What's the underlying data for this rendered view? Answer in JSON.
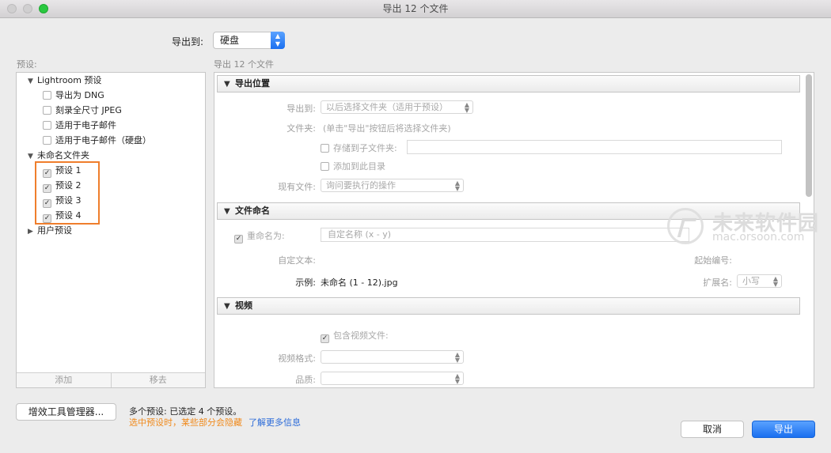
{
  "window": {
    "title": "导出 12 个文件"
  },
  "export_to": {
    "label": "导出到:",
    "value": "硬盘"
  },
  "presets": {
    "heading": "预设:",
    "groups": [
      {
        "label": "Lightroom 预设",
        "expanded": true,
        "items": [
          {
            "label": "导出为 DNG",
            "checked": false
          },
          {
            "label": "刻录全尺寸 JPEG",
            "checked": false
          },
          {
            "label": "适用于电子邮件",
            "checked": false
          },
          {
            "label": "适用于电子邮件（硬盘）",
            "checked": false
          }
        ]
      },
      {
        "label": "未命名文件夹",
        "expanded": true,
        "items": [
          {
            "label": "预设 1",
            "checked": true
          },
          {
            "label": "预设 2",
            "checked": true
          },
          {
            "label": "预设 3",
            "checked": true
          },
          {
            "label": "预设 4",
            "checked": true
          }
        ]
      },
      {
        "label": "用户预设",
        "expanded": false,
        "items": []
      }
    ],
    "add_button": "添加",
    "remove_button": "移去"
  },
  "settings": {
    "heading": "导出 12 个文件",
    "export_location": {
      "title": "导出位置",
      "export_to_label": "导出到:",
      "export_to_value": "以后选择文件夹（适用于预设）",
      "folder_label": "文件夹:",
      "folder_value": "(单击\"导出\"按钮后将选择文件夹)",
      "subfolder_label": "存储到子文件夹:",
      "add_to_catalog_label": "添加到此目录",
      "existing_files_label": "现有文件:",
      "existing_files_value": "询问要执行的操作"
    },
    "file_naming": {
      "title": "文件命名",
      "rename_label": "重命名为:",
      "rename_value": "自定名称 (x - y)",
      "custom_text_label": "自定文本:",
      "start_number_label": "起始编号:",
      "example_label": "示例:",
      "example_value": "未命名 (1 - 12).jpg",
      "extension_label": "扩展名:",
      "extension_value": "小写"
    },
    "video": {
      "title": "视频",
      "include_video_label": "包含视频文件:",
      "format_label": "视频格式:",
      "quality_label": "品质:"
    }
  },
  "footer": {
    "plugin_manager_button": "增效工具管理器...",
    "status_line": "多个预设: 已选定 4 个预设。",
    "warning_line": "选中预设时，某些部分会隐藏",
    "learn_more_link": "了解更多信息",
    "cancel_button": "取消",
    "export_button": "导出"
  },
  "watermark": {
    "brand": "未来软件园",
    "url": "mac.orsoon.com"
  },
  "colors": {
    "accent": "#1a6ff0",
    "highlight_border": "#ef7e2c",
    "warning_text": "#f08a1c",
    "link": "#2a6ad8"
  }
}
